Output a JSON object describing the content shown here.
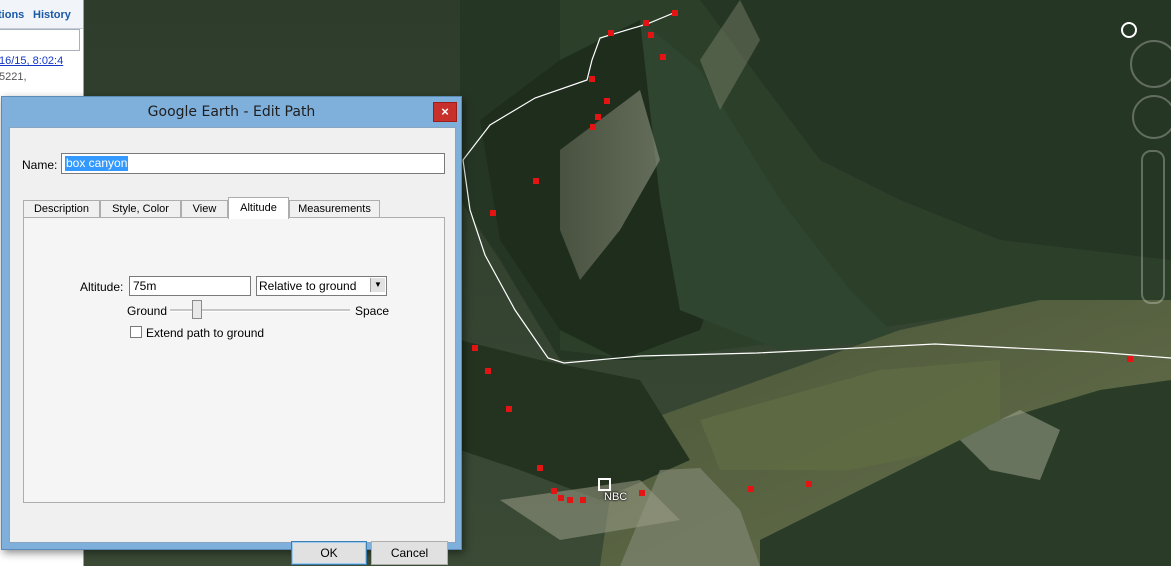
{
  "sidebar": {
    "tabs": [
      "tions",
      "History"
    ],
    "result_link": "16/15, 8:02:4",
    "result_text": "5221,"
  },
  "map": {
    "placemark_label": "NBC",
    "path_color": "#ffffff",
    "marker_color": "#e41414"
  },
  "dialog": {
    "title": "Google Earth - Edit Path",
    "close_label": "×",
    "name_label": "Name:",
    "name_value": "box canyon",
    "tabs": [
      "Description",
      "Style, Color",
      "View",
      "Altitude",
      "Measurements"
    ],
    "active_tab": "Altitude",
    "altitude": {
      "label": "Altitude:",
      "value": "75m",
      "mode": "Relative to ground",
      "slider_left_label": "Ground",
      "slider_right_label": "Space",
      "slider_level": 0.12,
      "extend_label": "Extend path to ground",
      "extend_checked": false
    },
    "ok_label": "OK",
    "cancel_label": "Cancel"
  }
}
